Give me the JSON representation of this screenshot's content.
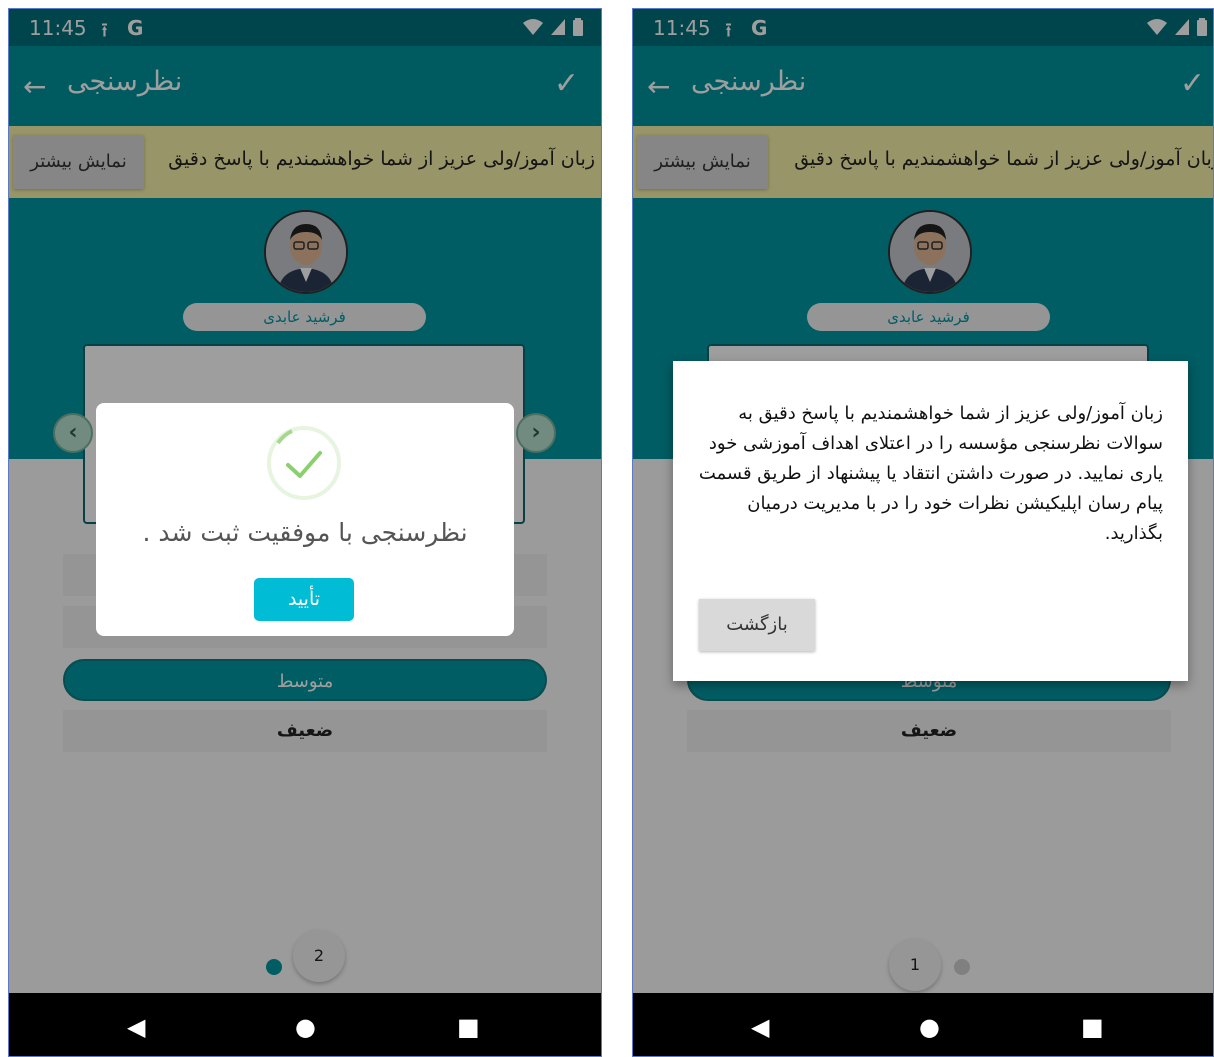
{
  "left": {
    "status": {
      "time": "11:45"
    },
    "appbar": {
      "title": "نظرسنجی"
    },
    "banner": {
      "text": "زبان آموز/ولی عزیز از شما خواهشمندیم با پاسخ دقیق",
      "more_label": "نمایش بیشتر"
    },
    "teacher": {
      "name": "فرشید عابدی"
    },
    "options": [
      {
        "label": "",
        "selected": false
      },
      {
        "label": "",
        "selected": false
      },
      {
        "label": "متوسط",
        "selected": true
      },
      {
        "label": "ضعیف",
        "selected": false
      }
    ],
    "pager": {
      "current_page": "2"
    },
    "dialog": {
      "message": "نظرسنجی با موفقیت ثبت شد .",
      "ok_label": "تأیید"
    }
  },
  "right": {
    "status": {
      "time": "11:45"
    },
    "appbar": {
      "title": "نظرسنجی"
    },
    "banner": {
      "text": "زبان آموز/ولی عزیز از شما خواهشمندیم با پاسخ دقیق",
      "more_label": "نمایش بیشتر"
    },
    "teacher": {
      "name": "فرشید عابدی"
    },
    "options": [
      {
        "label": "متوسط"
      },
      {
        "label": "ضعیف"
      }
    ],
    "pager": {
      "current_page": "1"
    },
    "dialog": {
      "text": "زبان آموز/ولی عزیز از شما خواهشمندیم با پاسخ دقیق به سوالات نظرسنجی مؤسسه را در اعتلای اهداف آموزشی خود یاری نمایید. در صورت داشتن انتقاد یا پیشنهاد از طریق قسمت پیام رسان اپلیکیشن نظرات خود را در با مدیریت درمیان بگذارید.",
      "back_label": "بازگشت"
    }
  },
  "colors": {
    "primary": "#00939d",
    "statusbar": "#00707a",
    "accent": "#00bcd4",
    "banner": "#f5f0a8"
  },
  "icons": [
    "upload-icon",
    "google-icon",
    "wifi-icon",
    "signal-icon",
    "battery-icon",
    "back-arrow-icon",
    "check-icon",
    "success-check-icon",
    "chevron-left-icon",
    "chevron-right-icon",
    "nav-back-icon",
    "nav-home-icon",
    "nav-recents-icon"
  ]
}
